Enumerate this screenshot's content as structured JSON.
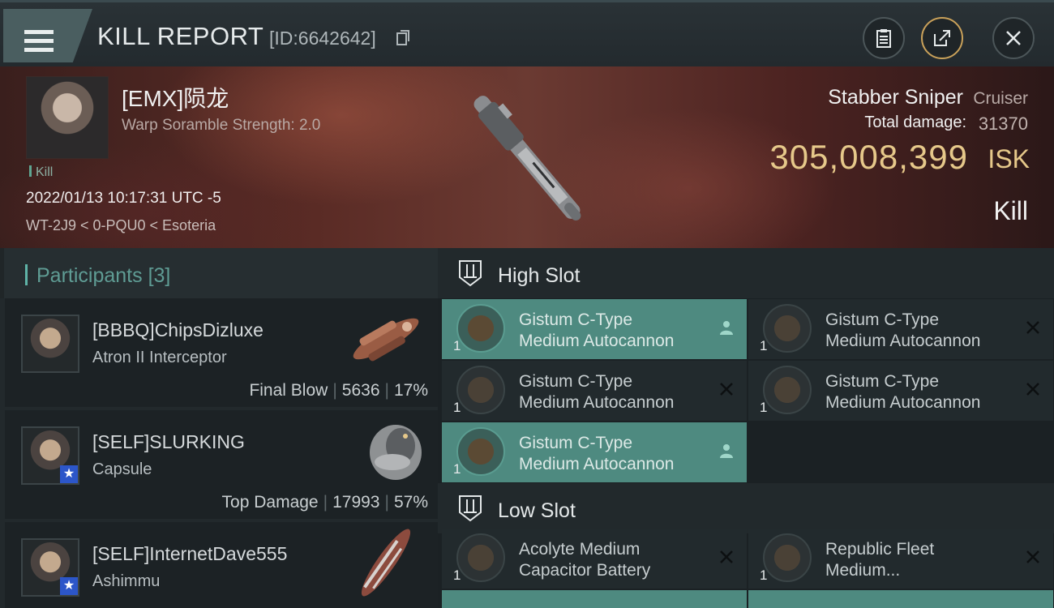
{
  "header": {
    "title": "KILL REPORT",
    "report_id": "[ID:6642642]"
  },
  "victim": {
    "name": "[EMX]陨龙",
    "scram": "Warp Soramble Strength: 2.0",
    "tag": "Kill",
    "timestamp": "2022/01/13 10:17:31 UTC -5",
    "location": "WT-2J9 < 0-PQU0 < Esoteria"
  },
  "ship": {
    "name": "Stabber Sniper",
    "class": "Cruiser",
    "damage_label": "Total damage:",
    "damage_value": "31370",
    "isk_value": "305,008,399",
    "isk_unit": "ISK",
    "result": "Kill"
  },
  "participants": {
    "label": "Participants",
    "count": "[3]",
    "rows": [
      {
        "name": "[BBBQ]ChipsDizluxe",
        "ship": "Atron II Interceptor",
        "role": "Final Blow",
        "damage": "5636",
        "percent": "17%"
      },
      {
        "name": "[SELF]SLURKING",
        "ship": "Capsule",
        "role": "Top Damage",
        "damage": "17993",
        "percent": "57%"
      },
      {
        "name": "[SELF]InternetDave555",
        "ship": "Ashimmu",
        "role": "",
        "damage": "",
        "percent": ""
      }
    ]
  },
  "fitting": {
    "high_slot_label": "High Slot",
    "low_slot_label": "Low Slot",
    "high": [
      {
        "n1": "Gistum C-Type",
        "n2": "Medium Autocannon",
        "qty": "1",
        "state": "dropped"
      },
      {
        "n1": "Gistum C-Type",
        "n2": "Medium Autocannon",
        "qty": "1",
        "state": "destroyed"
      },
      {
        "n1": "Gistum C-Type",
        "n2": "Medium Autocannon",
        "qty": "1",
        "state": "destroyed"
      },
      {
        "n1": "Gistum C-Type",
        "n2": "Medium Autocannon",
        "qty": "1",
        "state": "destroyed"
      },
      {
        "n1": "Gistum C-Type",
        "n2": "Medium Autocannon",
        "qty": "1",
        "state": "dropped"
      }
    ],
    "low": [
      {
        "n1": "Acolyte Medium",
        "n2": "Capacitor Battery",
        "qty": "1",
        "state": "destroyed"
      },
      {
        "n1": "Republic Fleet",
        "n2": "Medium...",
        "qty": "1",
        "state": "destroyed"
      }
    ]
  },
  "colors": {
    "accent": "#4e8a80",
    "isk": "#e6c88a"
  }
}
